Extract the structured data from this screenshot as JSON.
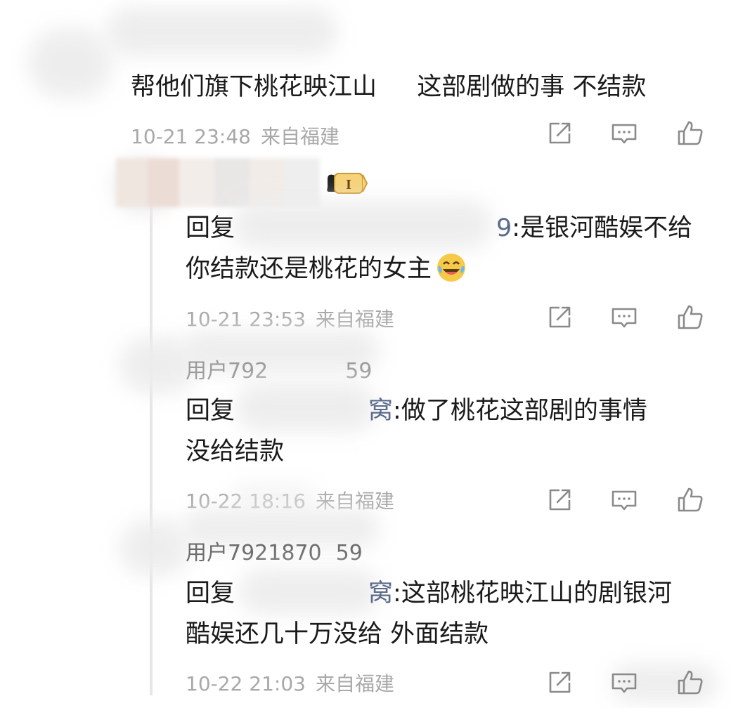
{
  "comments": [
    {
      "text_lines": [
        "帮他们旗下桃花映江山 　 这部剧做的事  不结款"
      ],
      "time": "10-21 23:48",
      "location": "来自福建"
    },
    {
      "username": "",
      "reply_prefix": "回复",
      "mention": "9",
      "text_lines": [
        ":是银河酷娱不给",
        "你结款还是桃花的女主"
      ],
      "time": "10-21 23:53",
      "location": "来自福建"
    },
    {
      "username": "用户792",
      "username_tail": "59",
      "reply_prefix": "回复",
      "mention": "窝",
      "text_lines": [
        ":做了桃花这部剧的事情",
        "没给结款"
      ],
      "time": "10-22 18:16",
      "location": "来自福建"
    },
    {
      "username": "用户7921870",
      "username_tail": "59",
      "reply_prefix": "回复",
      "mention": "窝",
      "text_lines": [
        ":这部桃花映江山的剧银河",
        "酷娱还几十万没给  外面结款"
      ],
      "time": "10-22 21:03",
      "location": "来自福建"
    }
  ],
  "badge_text": "I",
  "icons": {
    "share": "share-icon",
    "comment": "comment-icon",
    "like": "like-icon",
    "emoji": "laughing-tears-emoji"
  }
}
